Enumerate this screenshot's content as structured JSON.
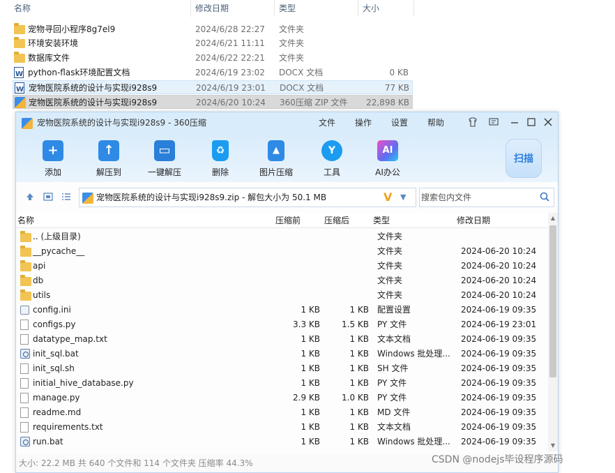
{
  "explorer": {
    "columns": {
      "name": "名称",
      "date": "修改日期",
      "type": "类型",
      "size": "大小"
    },
    "rows": [
      {
        "icon": "folder-icon",
        "name": "宠物寻回小程序8g7el9",
        "date": "2024/6/28 22:27",
        "type": "文件夹",
        "size": ""
      },
      {
        "icon": "folder-icon",
        "name": "环境安装环境",
        "date": "2024/6/21 11:11",
        "type": "文件夹",
        "size": ""
      },
      {
        "icon": "folder-icon",
        "name": "数据库文件",
        "date": "2024/6/22 22:21",
        "type": "文件夹",
        "size": ""
      },
      {
        "icon": "word-document-icon",
        "name": "python-flask环境配置文档",
        "date": "2024/6/19 23:02",
        "type": "DOCX 文档",
        "size": "0 KB"
      },
      {
        "icon": "word-document-icon",
        "name": "宠物医院系统的设计与实现i928s9",
        "date": "2024/6/19 23:01",
        "type": "DOCX 文档",
        "size": "77 KB"
      },
      {
        "icon": "zip-archive-icon",
        "name": "宠物医院系统的设计与实现i928s9",
        "date": "2024/6/20 10:24",
        "type": "360压缩 ZIP 文件",
        "size": "22,898 KB"
      }
    ]
  },
  "zipwin": {
    "title": "宠物医院系统的设计与实现i928s9 - 360压缩",
    "menu": [
      "文件",
      "操作",
      "设置",
      "帮助"
    ],
    "tools": [
      {
        "label": "添加",
        "icon": "add-icon"
      },
      {
        "label": "解压到",
        "icon": "extract-to-icon"
      },
      {
        "label": "一键解压",
        "icon": "one-click-extract-icon"
      },
      {
        "label": "删除",
        "icon": "recycle-bin-icon"
      },
      {
        "label": "图片压缩",
        "icon": "image-compress-icon"
      },
      {
        "label": "工具",
        "icon": "tools-icon"
      },
      {
        "label": "AI办公",
        "icon": "ai-office-icon",
        "badge": "AI"
      }
    ],
    "scan_label": "扫描",
    "address": "宠物医院系统的设计与实现i928s9.zip - 解包大小为 50.1 MB",
    "address_logo": "V",
    "search_placeholder": "搜索包内文件",
    "columns": {
      "name": "名称",
      "pre": "压缩前",
      "post": "压缩后",
      "type": "类型",
      "date": "修改日期"
    },
    "rows": [
      {
        "icon": "folder-icon",
        "name": ".. (上级目录)",
        "pre": "",
        "post": "",
        "type": "文件夹",
        "date": ""
      },
      {
        "icon": "folder-icon",
        "name": "__pycache__",
        "pre": "",
        "post": "",
        "type": "文件夹",
        "date": "2024-06-20 10:24"
      },
      {
        "icon": "folder-icon",
        "name": "api",
        "pre": "",
        "post": "",
        "type": "文件夹",
        "date": "2024-06-20 10:24"
      },
      {
        "icon": "folder-icon",
        "name": "db",
        "pre": "",
        "post": "",
        "type": "文件夹",
        "date": "2024-06-20 10:24"
      },
      {
        "icon": "folder-icon",
        "name": "utils",
        "pre": "",
        "post": "",
        "type": "文件夹",
        "date": "2024-06-20 10:24"
      },
      {
        "icon": "config-file-icon",
        "name": "config.ini",
        "pre": "1 KB",
        "post": "1 KB",
        "type": "配置设置",
        "date": "2024-06-19 09:35"
      },
      {
        "icon": "file-icon",
        "name": "configs.py",
        "pre": "3.3 KB",
        "post": "1.5 KB",
        "type": "PY 文件",
        "date": "2024-06-19 23:01"
      },
      {
        "icon": "file-icon",
        "name": "datatype_map.txt",
        "pre": "1 KB",
        "post": "1 KB",
        "type": "文本文档",
        "date": "2024-06-19 09:35"
      },
      {
        "icon": "batch-file-icon",
        "name": "init_sql.bat",
        "pre": "1 KB",
        "post": "1 KB",
        "type": "Windows 批处理...",
        "date": "2024-06-19 09:35"
      },
      {
        "icon": "file-icon",
        "name": "init_sql.sh",
        "pre": "1 KB",
        "post": "1 KB",
        "type": "SH 文件",
        "date": "2024-06-19 09:35"
      },
      {
        "icon": "file-icon",
        "name": "initial_hive_database.py",
        "pre": "1 KB",
        "post": "1 KB",
        "type": "PY 文件",
        "date": "2024-06-19 09:35"
      },
      {
        "icon": "file-icon",
        "name": "manage.py",
        "pre": "2.9 KB",
        "post": "1.0 KB",
        "type": "PY 文件",
        "date": "2024-06-19 09:35"
      },
      {
        "icon": "file-icon",
        "name": "readme.md",
        "pre": "1 KB",
        "post": "1 KB",
        "type": "MD 文件",
        "date": "2024-06-19 09:35"
      },
      {
        "icon": "file-icon",
        "name": "requirements.txt",
        "pre": "1 KB",
        "post": "1 KB",
        "type": "文本文档",
        "date": "2024-06-19 09:35"
      },
      {
        "icon": "batch-file-icon",
        "name": "run.bat",
        "pre": "1 KB",
        "post": "1 KB",
        "type": "Windows 批处理...",
        "date": "2024-06-19 09:35"
      }
    ],
    "status": "大小: 22.2 MB 共 640 个文件和 114 个文件夹 压缩率 44.3%"
  },
  "watermark": "CSDN @nodejs毕设程序源码",
  "colors": {
    "titlebar": "#d9ecfb",
    "accent": "#2f8ae6",
    "selection": "#e5f1fb"
  }
}
